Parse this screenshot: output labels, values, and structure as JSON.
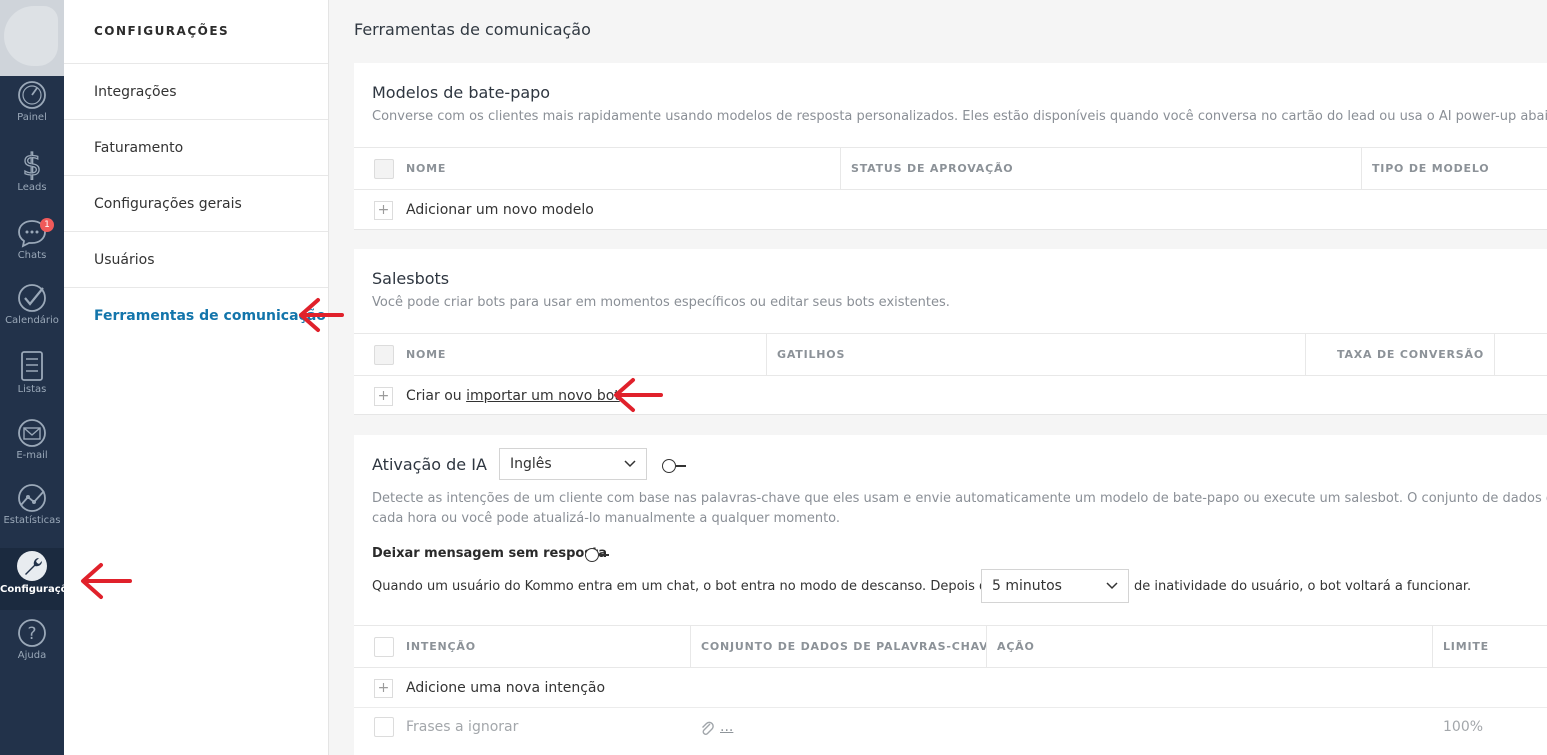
{
  "nav": {
    "items": [
      {
        "label": "Painel",
        "icon": "dashboard-icon"
      },
      {
        "label": "Leads",
        "icon": "dollar-icon"
      },
      {
        "label": "Chats",
        "icon": "chat-icon",
        "badge": "1"
      },
      {
        "label": "Calendário",
        "icon": "check-icon"
      },
      {
        "label": "Listas",
        "icon": "list-icon"
      },
      {
        "label": "E-mail",
        "icon": "mail-icon"
      },
      {
        "label": "Estatísticas",
        "icon": "stats-icon"
      },
      {
        "label": "Configurações",
        "icon": "wrench-icon"
      },
      {
        "label": "Ajuda",
        "icon": "help-icon"
      }
    ]
  },
  "settings": {
    "title": "CONFIGURAÇÕES",
    "items": [
      {
        "label": "Integrações"
      },
      {
        "label": "Faturamento"
      },
      {
        "label": "Configurações gerais"
      },
      {
        "label": "Usuários"
      },
      {
        "label": "Ferramentas de comunicação"
      }
    ]
  },
  "page": {
    "title": "Ferramentas de comunicação"
  },
  "templates": {
    "title": "Modelos de bate-papo",
    "description": "Converse com os clientes mais rapidamente usando modelos de resposta personalizados. Eles estão disponíveis quando você conversa no cartão do lead ou usa o AI power-up abaixo.",
    "columns": [
      "NOME",
      "STATUS DE APROVAÇÃO",
      "TIPO DE MODELO"
    ],
    "add_label": "Adicionar um novo modelo"
  },
  "salesbots": {
    "title": "Salesbots",
    "description": "Você pode criar bots para usar em momentos específicos ou editar seus bots existentes.",
    "columns": [
      "NOME",
      "GATILHOS",
      "TAXA DE CONVERSÃO"
    ],
    "add_prefix": "Criar ou ",
    "add_link": "importar um novo bot"
  },
  "ai": {
    "title": "Ativação de IA",
    "language": "Inglês",
    "description_line1": "Detecte as intenções de um cliente com base nas palavras-chave que eles usam e envie automaticamente um modelo de bate-papo ou execute um salesbot. O conjunto de dados de pa",
    "description_line2": "cada hora ou você pode atualizá-lo manualmente a qualquer momento.",
    "unanswered_label": "Deixar mensagem sem resposta",
    "rest_prefix": "Quando um usuário do Kommo entra em um chat, o bot entra no modo de descanso. Depois de",
    "rest_value": "5 minutos",
    "rest_suffix": "de inatividade do usuário, o bot voltará a funcionar.",
    "columns": [
      "INTENÇÃO",
      "CONJUNTO DE DADOS DE PALAVRAS-CHAVE",
      "AÇÃO",
      "LIMITE"
    ],
    "add_label": "Adicione uma nova intenção",
    "ignore_row": {
      "label": "Frases a ignorar",
      "dataset": "...",
      "limit": "100%"
    }
  },
  "colors": {
    "nav_bg": "#22324a",
    "accent": "#1375ab",
    "arrow": "#e0212b",
    "badge": "#f05a5a"
  }
}
